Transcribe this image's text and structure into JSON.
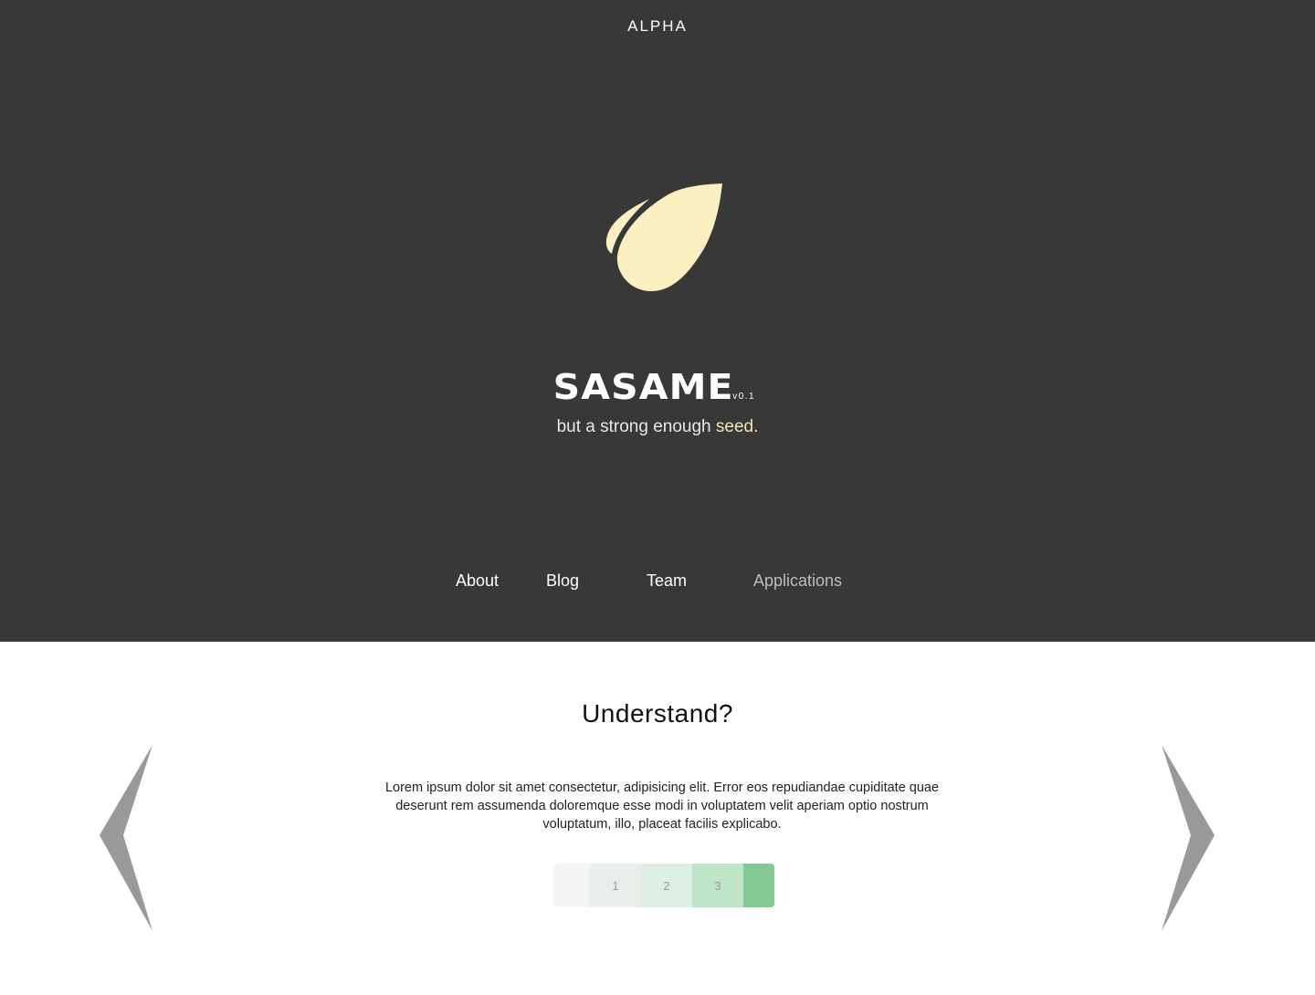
{
  "header": {
    "label": "ALPHA"
  },
  "hero": {
    "brand_name": "SASAME",
    "version": "v0.1",
    "tagline_prefix": "but a strong enough ",
    "tagline_accent": "seed",
    "tagline_suffix": ".",
    "logo_icon": "seed-leaf-icon"
  },
  "nav": {
    "items": [
      {
        "label": "About"
      },
      {
        "label": "Blog"
      },
      {
        "label": "Team"
      },
      {
        "label": "Applications"
      }
    ]
  },
  "section": {
    "title": "Understand?",
    "body": "Lorem ipsum dolor sit amet consectetur, adipisicing elit. Error eos repudiandae cupiditate quae deserunt rem assumenda doloremque esse modi in voluptatem velit aperiam optio nostrum voluptatum, illo, placeat facilis explicabo."
  },
  "rating_scale": {
    "cells": [
      {
        "label": ""
      },
      {
        "label": "1"
      },
      {
        "label": "2"
      },
      {
        "label": "3"
      },
      {
        "label": ""
      }
    ]
  },
  "carousel": {
    "prev_icon": "chevron-left-icon",
    "next_icon": "chevron-right-icon"
  },
  "colors": {
    "hero_background": "#383838",
    "accent": "#f4e6b3",
    "logo": "#fdf0c0",
    "arrow": "#999999",
    "scale": [
      "#f5f5f5",
      "#e8efea",
      "#ddeee2",
      "#bfe5c9",
      "#85c995"
    ]
  }
}
